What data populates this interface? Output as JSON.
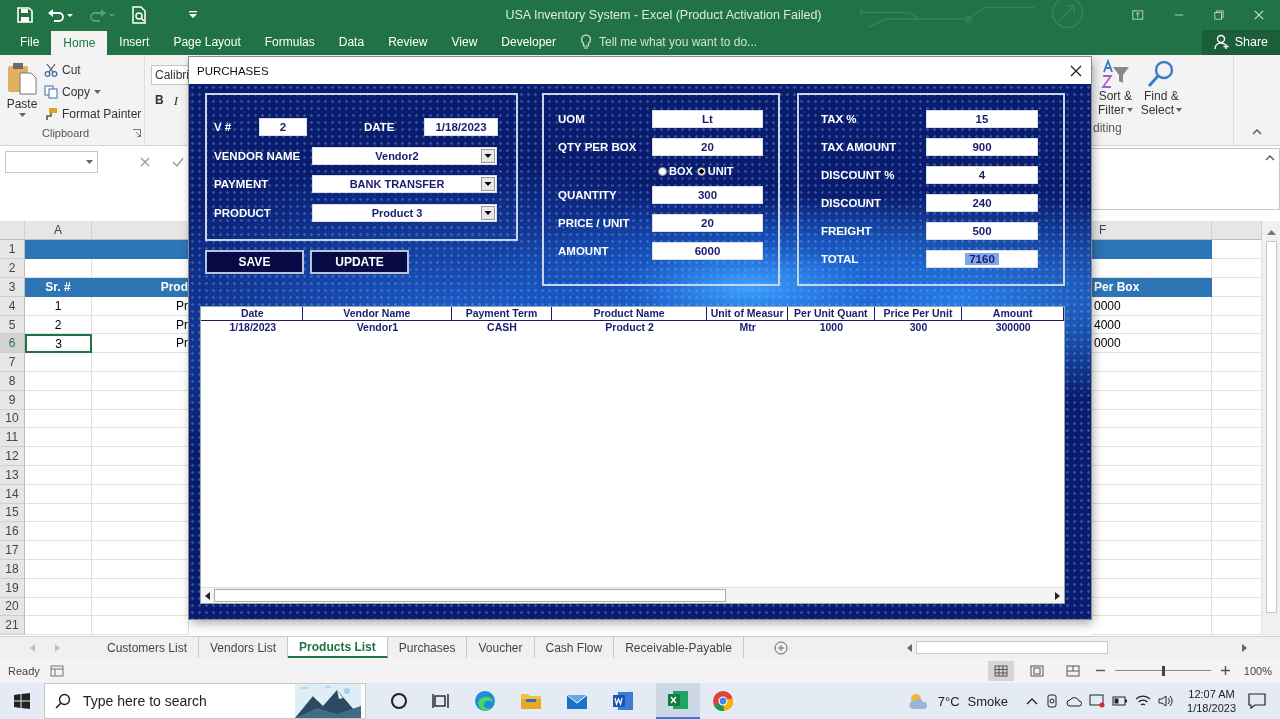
{
  "window": {
    "title": "USA Inventory System - Excel (Product Activation Failed)"
  },
  "ribbon_tabs": [
    {
      "label": "File",
      "selected": false
    },
    {
      "label": "Home",
      "selected": true
    },
    {
      "label": "Insert",
      "selected": false
    },
    {
      "label": "Page Layout",
      "selected": false
    },
    {
      "label": "Formulas",
      "selected": false
    },
    {
      "label": "Data",
      "selected": false
    },
    {
      "label": "Review",
      "selected": false
    },
    {
      "label": "View",
      "selected": false
    },
    {
      "label": "Developer",
      "selected": false
    }
  ],
  "tell_me": {
    "placeholder": "Tell me what you want to do..."
  },
  "share": "Share",
  "ribbon": {
    "paste": "Paste",
    "cut": "Cut",
    "copy": "Copy",
    "format_painter": "Format Painter",
    "clipboard_label": "Clipboard",
    "font": "Calibri",
    "bold": "B",
    "italic": "I",
    "sort_filter": [
      "Sort &",
      "Filter"
    ],
    "find_select": [
      "Find &",
      "Select"
    ],
    "editing_label": "diting"
  },
  "sheet": {
    "columns": [
      "A",
      "F"
    ],
    "rows": [
      {
        "number": "1",
        "kind": "band"
      },
      {
        "number": "2",
        "kind": "empty"
      },
      {
        "number": "3",
        "kind": "header",
        "cells": [
          {
            "text": "Sr. #",
            "selected": false
          },
          {
            "text": "Prod",
            "selected": false
          },
          {
            "text": "Per Box",
            "selected": false
          }
        ]
      },
      {
        "number": "4",
        "kind": "data",
        "cells": [
          {
            "text": "1",
            "selected": false
          },
          {
            "text": "Pr",
            "selected": false
          },
          {
            "text": "0000",
            "selected": false
          }
        ]
      },
      {
        "number": "5",
        "kind": "data",
        "cells": [
          {
            "text": "2",
            "selected": false
          },
          {
            "text": "Pr",
            "selected": false
          },
          {
            "text": "4000",
            "selected": false
          }
        ]
      },
      {
        "number": "6",
        "kind": "data",
        "cells": [
          {
            "text": "3",
            "selected": true
          },
          {
            "text": "Pr",
            "selected": false
          },
          {
            "text": "0000",
            "selected": false
          }
        ]
      },
      {
        "number": "7",
        "kind": "empty"
      },
      {
        "number": "8",
        "kind": "empty"
      },
      {
        "number": "9",
        "kind": "empty"
      },
      {
        "number": "10",
        "kind": "empty"
      },
      {
        "number": "11",
        "kind": "empty"
      },
      {
        "number": "12",
        "kind": "empty"
      },
      {
        "number": "13",
        "kind": "empty"
      },
      {
        "number": "14",
        "kind": "empty"
      },
      {
        "number": "15",
        "kind": "empty"
      },
      {
        "number": "16",
        "kind": "empty"
      },
      {
        "number": "17",
        "kind": "empty"
      },
      {
        "number": "18",
        "kind": "empty"
      },
      {
        "number": "19",
        "kind": "empty"
      },
      {
        "number": "20",
        "kind": "empty"
      },
      {
        "number": "21",
        "kind": "empty"
      }
    ]
  },
  "dialog": {
    "title": "PURCHASES",
    "vendor_frame": {
      "voucher": {
        "label": "V #",
        "value": "2"
      },
      "date": {
        "label": "DATE",
        "value": "1/18/2023"
      },
      "dropdowns": [
        {
          "label": "VENDOR NAME",
          "value": "Vendor2"
        },
        {
          "label": "PAYMENT",
          "value": "BANK TRANSFER"
        },
        {
          "label": "PRODUCT",
          "value": "Product 3"
        }
      ]
    },
    "buttons": [
      "SAVE",
      "UPDATE"
    ],
    "quantity_frame": {
      "fields_top": [
        {
          "label": "UOM",
          "value": "Lt"
        },
        {
          "label": "QTY PER BOX",
          "value": "20"
        }
      ],
      "options": [
        {
          "label": "BOX",
          "selected": false
        },
        {
          "label": "UNIT",
          "selected": true
        }
      ],
      "fields_bottom": [
        {
          "label": "QUANTITY",
          "value": "300"
        },
        {
          "label": "PRICE / UNIT",
          "value": "20"
        },
        {
          "label": "AMOUNT",
          "value": "6000"
        }
      ]
    },
    "totals_frame": {
      "fields": [
        {
          "label": "TAX %",
          "value": "15",
          "highlighted": false
        },
        {
          "label": "TAX AMOUNT",
          "value": "900",
          "highlighted": false
        },
        {
          "label": "DISCOUNT %",
          "value": "4",
          "highlighted": false
        },
        {
          "label": "DISCOUNT",
          "value": "240",
          "highlighted": false
        },
        {
          "label": "FREIGHT",
          "value": "500",
          "highlighted": false
        },
        {
          "label": "TOTAL",
          "value": "7160",
          "highlighted": true
        }
      ]
    },
    "list": {
      "columns": [
        "Date",
        "Vendor Name",
        "Payment Term",
        "Product Name",
        "Unit of Measur",
        "Per Unit Quant",
        "Price Per Unit",
        "Amount"
      ],
      "rows": [
        [
          "1/18/2023",
          "Vendor1",
          "CASH",
          "Product 2",
          "Mtr",
          "1000",
          "300",
          "300000"
        ]
      ]
    }
  },
  "sheet_tabs": [
    {
      "label": "Customers List",
      "selected": false
    },
    {
      "label": "Vendors List",
      "selected": false
    },
    {
      "label": "Products List",
      "selected": true
    },
    {
      "label": "Purchases",
      "selected": false
    },
    {
      "label": "Voucher",
      "selected": false
    },
    {
      "label": "Cash Flow",
      "selected": false
    },
    {
      "label": "Receivable-Payable",
      "selected": false
    }
  ],
  "status_bar": {
    "status": "Ready",
    "zoom": "100%",
    "zoom_slider": {
      "level": 0.5
    }
  },
  "taskbar": {
    "search": {
      "placeholder": "Type here to search"
    },
    "temperature": "7°C",
    "weather": "Smoke",
    "time": "12:07 AM",
    "date": "1/18/2023"
  }
}
